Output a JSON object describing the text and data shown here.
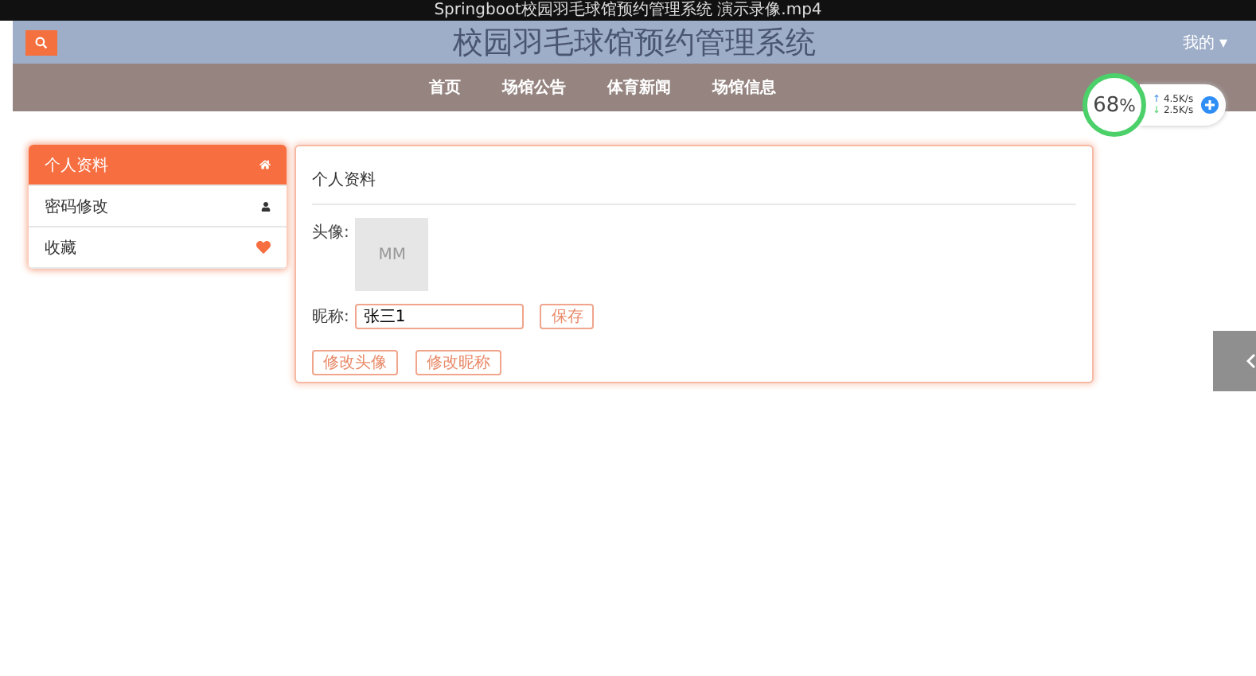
{
  "video_title": "Springboot校园羽毛球馆预约管理系统 演示录像.mp4",
  "header": {
    "title": "校园羽毛球馆预约管理系统",
    "user_menu": "我的",
    "caret": "▾"
  },
  "nav": [
    {
      "label": "首页"
    },
    {
      "label": "场馆公告"
    },
    {
      "label": "体育新闻"
    },
    {
      "label": "场馆信息"
    }
  ],
  "monitor": {
    "percent": "68",
    "unit": "%",
    "upload_arrow": "↑",
    "upload": "4.5K/s",
    "download_arrow": "↓",
    "download": "2.5K/s"
  },
  "sidebar": [
    {
      "label": "个人资料",
      "selected": true
    },
    {
      "label": "密码修改",
      "selected": false
    },
    {
      "label": "收藏",
      "selected": false
    }
  ],
  "profile": {
    "title": "个人资料",
    "avatar_label": "头像:",
    "avatar_text": "MM",
    "nickname_label": "昵称:",
    "nickname_value": "张三1",
    "save": "保存",
    "buttons": [
      "修改头像",
      "修改昵称"
    ]
  }
}
